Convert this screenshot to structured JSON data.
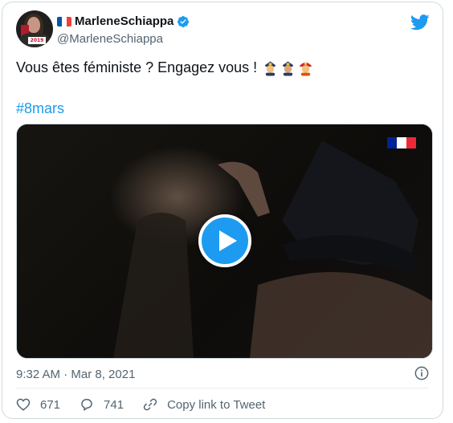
{
  "author": {
    "display_name": "MarleneSchiappa",
    "handle": "@MarleneSchiappa",
    "flag_icon": "france-flag-icon",
    "verified_icon": "verified-badge-icon",
    "avatar_tag": "2019"
  },
  "tweet": {
    "text": "Vous êtes féministe ? Engagez vous !",
    "emojis": [
      "police-officer-emoji",
      "police-officer-emoji",
      "firefighter-emoji"
    ],
    "hashtag": "#8mars"
  },
  "media": {
    "type": "video",
    "play_icon": "play-icon",
    "watermark_icon": "french-government-logo"
  },
  "meta": {
    "timestamp": "9:32 AM · Mar 8, 2021",
    "info_icon": "info-icon"
  },
  "actions": {
    "like_count": "671",
    "reply_count": "741",
    "copy_link_label": "Copy link to Tweet"
  },
  "colors": {
    "accent": "#1d9bf0",
    "text_primary": "#0f1419",
    "text_secondary": "#536471",
    "border": "#cfd9de"
  }
}
